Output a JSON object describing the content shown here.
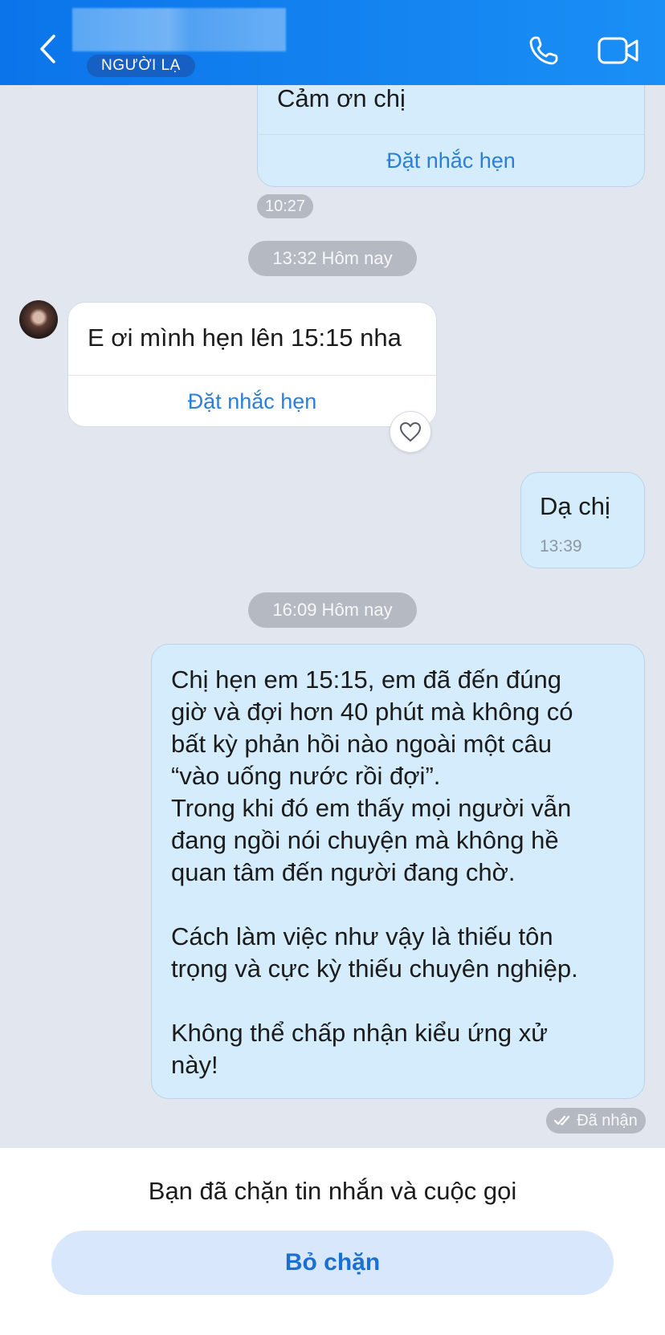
{
  "header": {
    "badge": "NGƯỜI LẠ",
    "icons": {
      "back": "chevron-left-icon",
      "call": "phone-icon",
      "video": "video-camera-icon"
    }
  },
  "messages": {
    "m1": {
      "text": "Cảm ơn chị",
      "action": "Đặt nhắc hẹn",
      "time": "10:27"
    },
    "sep1": "13:32 Hôm nay",
    "m2": {
      "text": "E ơi mình hẹn lên 15:15 nha",
      "action": "Đặt nhắc hẹn"
    },
    "m3": {
      "text": "Dạ chị",
      "time": "13:39"
    },
    "sep2": "16:09 Hôm nay",
    "m4": {
      "text": "Chị hẹn em 15:15, em đã đến đúng\ngiờ và đợi hơn 40 phút mà không có\nbất kỳ phản hồi nào ngoài một câu\n“vào uống nước rồi đợi”.\nTrong khi đó em thấy mọi người vẫn\nđang ngồi nói chuyện mà không hề\nquan tâm đến người đang chờ.\n\nCách làm việc như vậy là thiếu tôn\ntrọng và cực kỳ thiếu chuyên nghiệp.\n\nKhông thể chấp nhận kiểu ứng xử\nnày!"
    },
    "status": "Đã nhận"
  },
  "footer": {
    "blocked_notice": "Bạn đã chặn tin nhắn và cuộc gọi",
    "unblock_label": "Bỏ chặn"
  },
  "colors": {
    "header": "#0b74ea",
    "my_bubble": "#d4ecfb",
    "their_bubble": "#ffffff",
    "link": "#2a7fd8",
    "background": "#e2e6ef"
  }
}
